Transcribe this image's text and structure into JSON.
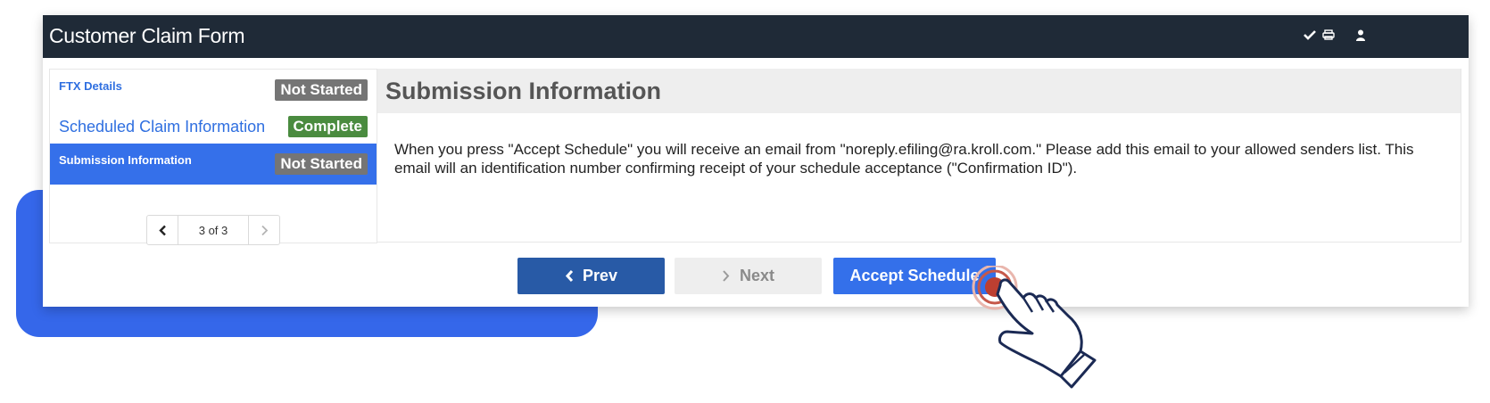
{
  "window": {
    "title": "Customer Claim Form",
    "icons": [
      "check-icon",
      "printer-icon",
      "user-icon"
    ]
  },
  "sidebar": {
    "items": [
      {
        "label": "FTX Details",
        "status": "Not Started",
        "status_color": "#757575"
      },
      {
        "label": "Scheduled Claim Information",
        "status": "Complete",
        "status_color": "#4a8b3f"
      },
      {
        "label": "Submission Information",
        "status": "Not Started",
        "status_color": "#757575",
        "active": true
      }
    ],
    "pager": {
      "label": "3 of 3"
    }
  },
  "main": {
    "heading": "Submission Information",
    "body": "When you press \"Accept Schedule\" you will receive an email from \"noreply.efiling@ra.kroll.com.\" Please add this email to your allowed senders list. This email will an identification number confirming receipt of your schedule acceptance (\"Confirmation ID\")."
  },
  "actions": {
    "prev_label": "Prev",
    "next_label": "Next",
    "accept_label": "Accept Schedule"
  },
  "colors": {
    "header_bg": "#1f2a37",
    "accent": "#3470ea",
    "prev_button": "#285aa6",
    "complete": "#4a8b3f",
    "not_started": "#757575"
  }
}
